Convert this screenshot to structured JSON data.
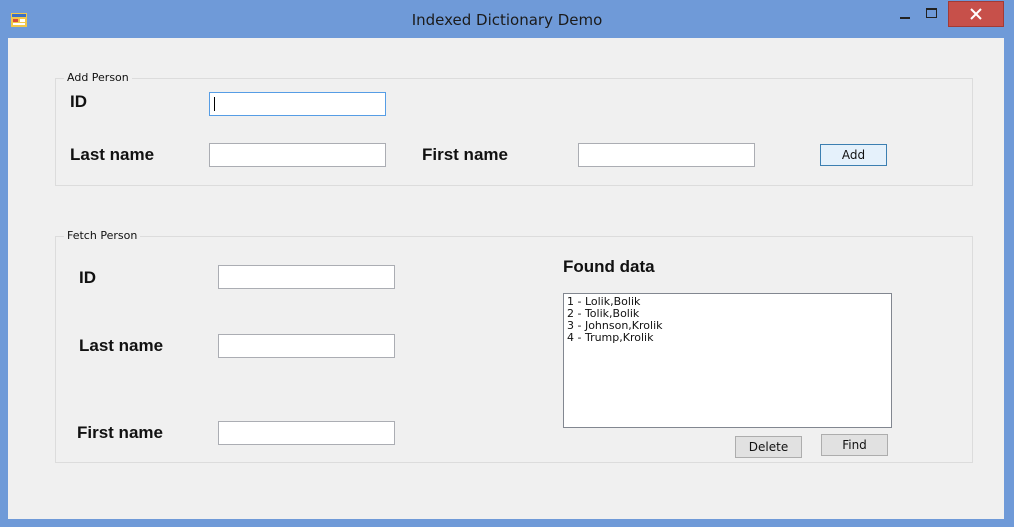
{
  "window": {
    "title": "Indexed Dictionary Demo"
  },
  "add_person": {
    "group_label": "Add Person",
    "id_label": "ID",
    "id_value": "",
    "last_name_label": "Last name",
    "last_name_value": "",
    "first_name_label": "First name",
    "first_name_value": "",
    "add_button": "Add"
  },
  "fetch_person": {
    "group_label": "Fetch Person",
    "id_label": "ID",
    "id_value": "",
    "last_name_label": "Last name",
    "last_name_value": "",
    "first_name_label": "First name",
    "first_name_value": "",
    "found_data_label": "Found data",
    "found_items": [
      "1 - Lolik,Bolik",
      "2 - Tolik,Bolik",
      "3 - Johnson,Krolik",
      "4 - Trump,Krolik"
    ],
    "delete_button": "Delete",
    "find_button": "Find"
  },
  "icons": {
    "app": "app-form-icon",
    "minimize": "minimize-icon",
    "maximize": "maximize-icon",
    "close": "close-icon"
  },
  "colors": {
    "title_bar": "#6f9ad8",
    "client": "#f0f0f0",
    "close_button": "#c7504a",
    "focus_border": "#569de5"
  }
}
